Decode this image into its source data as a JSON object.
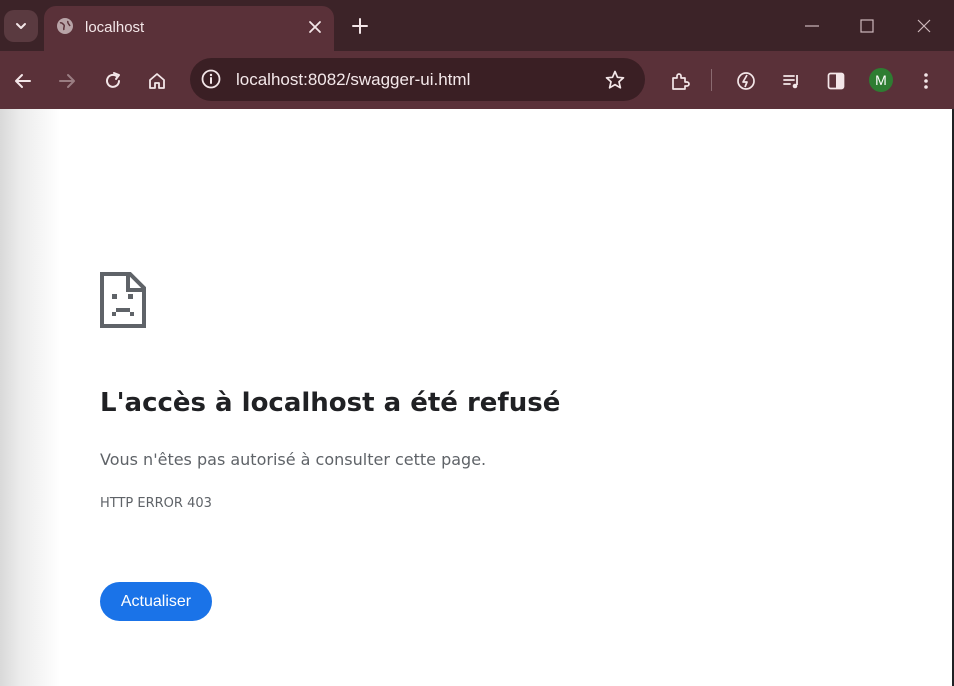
{
  "browser": {
    "tab": {
      "title": "localhost"
    },
    "address_bar": {
      "url": "localhost:8082/swagger-ui.html"
    },
    "profile": {
      "initial": "M",
      "color": "#2e7d32"
    },
    "theme": {
      "frame": "#3c2328",
      "toolbar": "#5a3139",
      "omnibox": "#3a1f24"
    }
  },
  "error_page": {
    "icon": "sad-document-icon",
    "title": "L'accès à localhost a été refusé",
    "description": "Vous n'êtes pas autorisé à consulter cette page.",
    "error_code": "HTTP ERROR 403",
    "reload_button": "Actualiser",
    "accent": "#1a73e8"
  }
}
